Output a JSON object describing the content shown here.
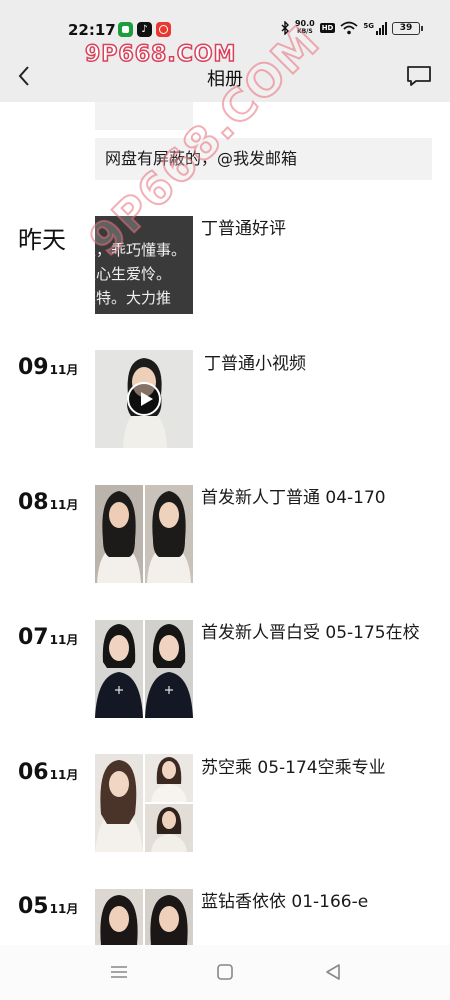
{
  "status_bar": {
    "time": "22:17",
    "net_speed_value": "90.0",
    "net_speed_unit": "KB/S",
    "hd_label": "HD",
    "signal_label": "5G",
    "battery": "39",
    "icons": [
      "wechat-icon",
      "tiktok-icon",
      "netease-music-icon",
      "bluetooth-icon",
      "wifi-icon",
      "signal-icon",
      "battery-icon"
    ]
  },
  "nav": {
    "title": "相册",
    "back_icon": "chevron-left-icon",
    "comment_icon": "message-icon"
  },
  "watermark": {
    "top": "9P668.COM",
    "diagonal": "9P668.COM"
  },
  "posts": {
    "text_post": "网盘有屏蔽的，@我发邮箱",
    "yesterday": {
      "date_label": "昨天",
      "thumb_lines": [
        "表，乖巧懂事。",
        "人心生爱怜。",
        "模特。大力推"
      ],
      "caption": "丁普通好评"
    },
    "d09": {
      "day": "09",
      "month": "11月",
      "caption": "丁普通小视频"
    },
    "d08": {
      "day": "08",
      "month": "11月",
      "caption": "首发新人丁普通 04-170"
    },
    "d07": {
      "day": "07",
      "month": "11月",
      "caption": "首发新人晋白受 05-175在校"
    },
    "d06": {
      "day": "06",
      "month": "11月",
      "caption": "苏空乘 05-174空乘专业"
    },
    "d05": {
      "day": "05",
      "month": "11月",
      "caption": "蓝钻香依依 01-166-e"
    }
  },
  "system_nav": {
    "icons": [
      "menu-icon",
      "home-icon",
      "back-triangle-icon"
    ]
  },
  "colors": {
    "header_bg": "#ededed",
    "card_bg": "#f2f2f2",
    "watermark": "#d9415b"
  }
}
